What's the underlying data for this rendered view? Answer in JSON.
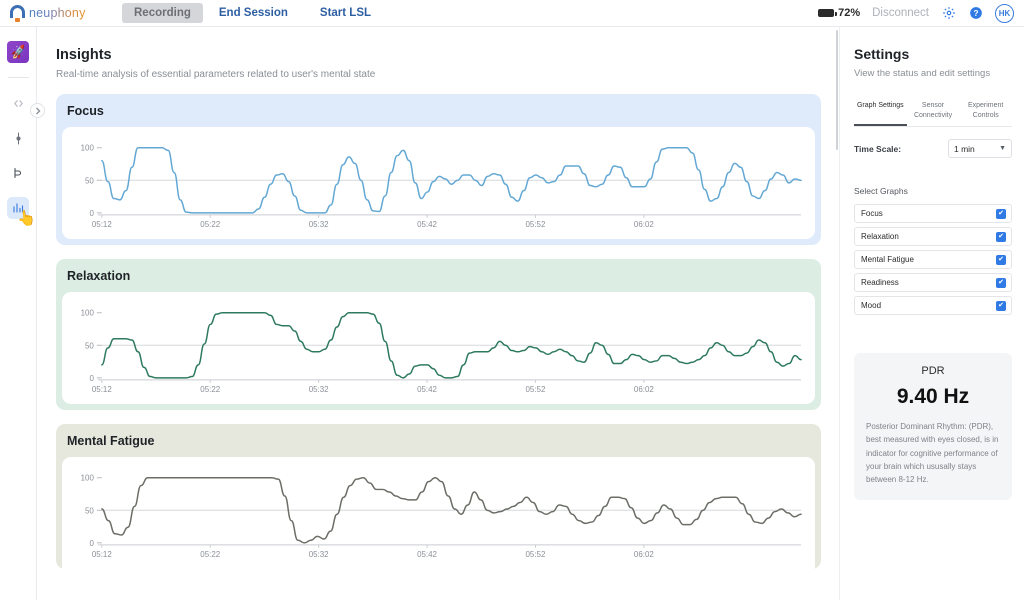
{
  "topbar": {
    "brand": "neuphony",
    "recording_label": "Recording",
    "end_session_label": "End Session",
    "start_lsl_label": "Start LSL",
    "battery_pct": "72%",
    "connection_status": "Disconnect",
    "settings_icon": "gear-icon",
    "help_icon": "help-circle-icon",
    "avatar_initials": "HK"
  },
  "rail": {
    "app_logo_icon": "rocket-icon",
    "toggle_icon": "chevron-right-icon",
    "items": [
      {
        "icon": "code-brackets-icon",
        "active": false
      },
      {
        "icon": "sensor-pin-icon",
        "active": false
      },
      {
        "icon": "signal-branch-icon",
        "active": false
      },
      {
        "icon": "insights-chart-icon",
        "active": true
      }
    ]
  },
  "page": {
    "title": "Insights",
    "subtitle": "Real-time analysis of essential parameters related to user's mental state"
  },
  "settings": {
    "title": "Settings",
    "subtitle": "View the status and edit settings",
    "tabs": [
      {
        "label": "Graph Settings",
        "active": true
      },
      {
        "label": "Sensor Connectivity",
        "active": false
      },
      {
        "label": "Experiment Controls",
        "active": false
      }
    ],
    "time_scale_label": "Time Scale:",
    "time_scale_value": "1 min",
    "time_scale_options": [
      "1 min"
    ],
    "select_graphs_label": "Select Graphs",
    "graphs": [
      {
        "label": "Focus",
        "checked": true
      },
      {
        "label": "Relaxation",
        "checked": true
      },
      {
        "label": "Mental Fatigue",
        "checked": true
      },
      {
        "label": "Readiness",
        "checked": true
      },
      {
        "label": "Mood",
        "checked": true
      }
    ],
    "pdr": {
      "title": "PDR",
      "value": "9.40 Hz",
      "description": "Posterior Dominant Rhythm: (PDR), best measured with eyes closed, is in indicator for cognitive performance of your brain which ususally stays between 8-12 Hz."
    }
  },
  "chart_data": [
    {
      "type": "line",
      "title": "Focus",
      "color": "#63a8d4",
      "header_bg": "#dfeafa",
      "xlabel": "",
      "ylabel": "",
      "ylim": [
        0,
        110
      ],
      "yticks": [
        0,
        50,
        100
      ],
      "ytick_labels": [
        "0",
        "50",
        "100"
      ],
      "xticks": [
        "05:12",
        "05:22",
        "05:32",
        "05:42",
        "05:52",
        "06:02"
      ],
      "grid": true,
      "values": [
        80,
        48,
        22,
        20,
        34,
        70,
        100,
        100,
        100,
        100,
        100,
        96,
        62,
        20,
        1,
        0,
        0,
        0,
        0,
        0,
        0,
        0,
        0,
        0,
        0,
        0,
        6,
        24,
        44,
        58,
        60,
        48,
        26,
        4,
        0,
        0,
        0,
        0,
        12,
        44,
        74,
        86,
        76,
        50,
        20,
        3,
        2,
        26,
        62,
        88,
        96,
        80,
        46,
        22,
        32,
        48,
        56,
        52,
        44,
        50,
        58,
        58,
        50,
        42,
        56,
        60,
        58,
        44,
        24,
        18,
        34,
        54,
        58,
        54,
        46,
        48,
        58,
        72,
        72,
        72,
        60,
        42,
        40,
        44,
        58,
        72,
        70,
        54,
        40,
        40,
        40,
        52,
        78,
        98,
        100,
        100,
        100,
        100,
        92,
        66,
        36,
        18,
        22,
        40,
        62,
        76,
        70,
        48,
        26,
        22,
        34,
        52,
        62,
        58,
        46,
        52,
        50
      ]
    },
    {
      "type": "line",
      "title": "Relaxation",
      "color": "#2e7a5e",
      "header_bg": "#dceee3",
      "xlabel": "",
      "ylabel": "",
      "ylim": [
        0,
        110
      ],
      "yticks": [
        0,
        50,
        100
      ],
      "ytick_labels": [
        "0",
        "50",
        "100"
      ],
      "xticks": [
        "05:12",
        "05:22",
        "05:32",
        "05:42",
        "05:52",
        "06:02"
      ],
      "grid": true,
      "values": [
        20,
        46,
        60,
        60,
        60,
        58,
        40,
        16,
        2,
        0,
        0,
        0,
        0,
        0,
        0,
        2,
        20,
        52,
        82,
        98,
        100,
        100,
        100,
        100,
        100,
        100,
        100,
        100,
        96,
        82,
        80,
        80,
        72,
        56,
        44,
        40,
        40,
        44,
        58,
        78,
        94,
        100,
        100,
        100,
        100,
        98,
        84,
        56,
        26,
        4,
        0,
        6,
        18,
        20,
        20,
        14,
        4,
        0,
        0,
        2,
        20,
        38,
        40,
        40,
        40,
        46,
        56,
        50,
        42,
        40,
        42,
        48,
        46,
        40,
        36,
        40,
        44,
        40,
        34,
        26,
        24,
        38,
        54,
        50,
        36,
        22,
        22,
        28,
        36,
        34,
        28,
        24,
        26,
        34,
        34,
        30,
        24,
        22,
        24,
        28,
        34,
        46,
        54,
        50,
        40,
        34,
        34,
        38,
        48,
        58,
        54,
        40,
        24,
        18,
        22,
        34,
        28
      ]
    },
    {
      "type": "line",
      "title": "Mental Fatigue",
      "color": "#6a6e66",
      "header_bg": "#e7e8dd",
      "xlabel": "",
      "ylabel": "",
      "ylim": [
        0,
        110
      ],
      "yticks": [
        0,
        50,
        100
      ],
      "ytick_labels": [
        "0",
        "50",
        "100"
      ],
      "xticks": [
        "05:12",
        "05:22",
        "05:32",
        "05:42",
        "05:52",
        "06:02"
      ],
      "grid": true,
      "values": [
        52,
        34,
        14,
        12,
        24,
        56,
        88,
        100,
        100,
        100,
        100,
        100,
        100,
        100,
        100,
        100,
        100,
        100,
        100,
        100,
        100,
        100,
        100,
        100,
        100,
        100,
        100,
        98,
        72,
        34,
        4,
        0,
        4,
        10,
        6,
        18,
        44,
        70,
        88,
        98,
        100,
        92,
        82,
        82,
        78,
        72,
        68,
        66,
        66,
        78,
        94,
        100,
        94,
        72,
        52,
        44,
        58,
        78,
        66,
        50,
        46,
        48,
        52,
        56,
        62,
        70,
        62,
        48,
        44,
        48,
        58,
        56,
        44,
        34,
        30,
        32,
        42,
        56,
        70,
        70,
        68,
        54,
        38,
        30,
        34,
        46,
        58,
        52,
        38,
        28,
        28,
        36,
        50,
        62,
        68,
        70,
        70,
        70,
        60,
        44,
        32,
        30,
        38,
        48,
        52,
        46,
        40,
        44
      ]
    }
  ]
}
